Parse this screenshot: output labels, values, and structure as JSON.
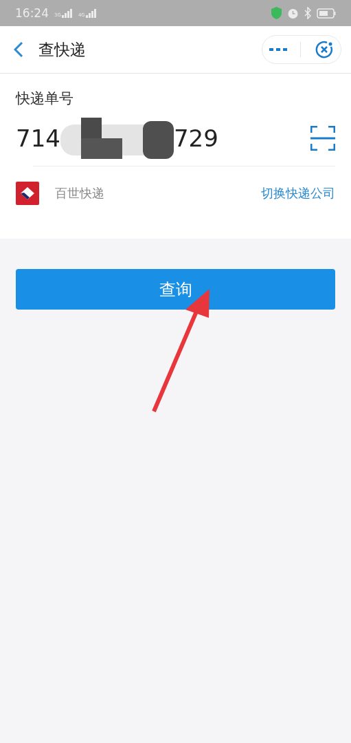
{
  "status_bar": {
    "time": "16:24",
    "networks": [
      "3G",
      "4G"
    ]
  },
  "header": {
    "title": "查快递"
  },
  "form": {
    "label": "快递单号",
    "number_start": "714",
    "number_end": "729",
    "number_redacted": true,
    "company": "百世快递",
    "switch_link": "切换快递公司"
  },
  "query_button": "查询"
}
